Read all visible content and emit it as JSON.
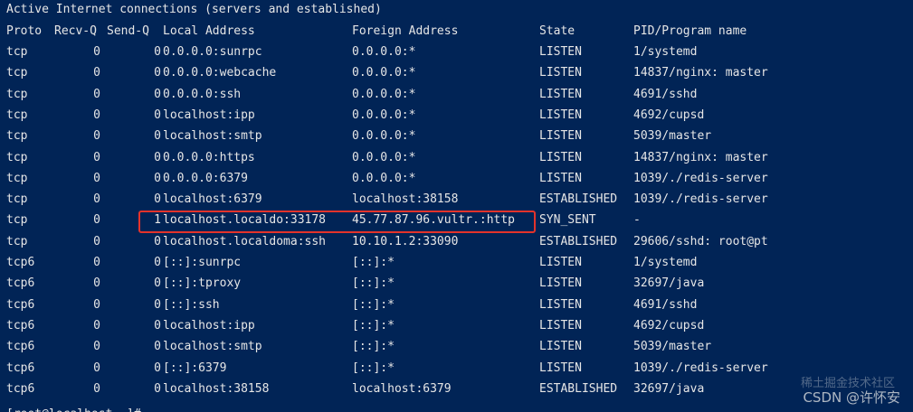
{
  "title_line": "Active Internet connections (servers and established)",
  "headers": {
    "proto": "Proto",
    "recv": "Recv-Q",
    "send": "Send-Q",
    "local": "Local Address",
    "foreign": "Foreign Address",
    "state": "State",
    "pid": "PID/Program name"
  },
  "rows": [
    {
      "proto": "tcp",
      "recv": "0",
      "send": "0",
      "local": "0.0.0.0:sunrpc",
      "foreign": "0.0.0.0:*",
      "state": "LISTEN",
      "pid": "1/systemd"
    },
    {
      "proto": "tcp",
      "recv": "0",
      "send": "0",
      "local": "0.0.0.0:webcache",
      "foreign": "0.0.0.0:*",
      "state": "LISTEN",
      "pid": "14837/nginx: master"
    },
    {
      "proto": "tcp",
      "recv": "0",
      "send": "0",
      "local": "0.0.0.0:ssh",
      "foreign": "0.0.0.0:*",
      "state": "LISTEN",
      "pid": "4691/sshd"
    },
    {
      "proto": "tcp",
      "recv": "0",
      "send": "0",
      "local": "localhost:ipp",
      "foreign": "0.0.0.0:*",
      "state": "LISTEN",
      "pid": "4692/cupsd"
    },
    {
      "proto": "tcp",
      "recv": "0",
      "send": "0",
      "local": "localhost:smtp",
      "foreign": "0.0.0.0:*",
      "state": "LISTEN",
      "pid": "5039/master"
    },
    {
      "proto": "tcp",
      "recv": "0",
      "send": "0",
      "local": "0.0.0.0:https",
      "foreign": "0.0.0.0:*",
      "state": "LISTEN",
      "pid": "14837/nginx: master"
    },
    {
      "proto": "tcp",
      "recv": "0",
      "send": "0",
      "local": "0.0.0.0:6379",
      "foreign": "0.0.0.0:*",
      "state": "LISTEN",
      "pid": "1039/./redis-server"
    },
    {
      "proto": "tcp",
      "recv": "0",
      "send": "0",
      "local": "localhost:6379",
      "foreign": "localhost:38158",
      "state": "ESTABLISHED",
      "pid": "1039/./redis-server"
    },
    {
      "proto": "tcp",
      "recv": "0",
      "send": "1",
      "local": "localhost.localdo:33178",
      "foreign": "45.77.87.96.vultr.:http",
      "state": "SYN_SENT",
      "pid": "-"
    },
    {
      "proto": "tcp",
      "recv": "0",
      "send": "0",
      "local": "localhost.localdoma:ssh",
      "foreign": "10.10.1.2:33090",
      "state": "ESTABLISHED",
      "pid": "29606/sshd: root@pt"
    },
    {
      "proto": "tcp6",
      "recv": "0",
      "send": "0",
      "local": "[::]:sunrpc",
      "foreign": "[::]:*",
      "state": "LISTEN",
      "pid": "1/systemd"
    },
    {
      "proto": "tcp6",
      "recv": "0",
      "send": "0",
      "local": "[::]:tproxy",
      "foreign": "[::]:*",
      "state": "LISTEN",
      "pid": "32697/java"
    },
    {
      "proto": "tcp6",
      "recv": "0",
      "send": "0",
      "local": "[::]:ssh",
      "foreign": "[::]:*",
      "state": "LISTEN",
      "pid": "4691/sshd"
    },
    {
      "proto": "tcp6",
      "recv": "0",
      "send": "0",
      "local": "localhost:ipp",
      "foreign": "[::]:*",
      "state": "LISTEN",
      "pid": "4692/cupsd"
    },
    {
      "proto": "tcp6",
      "recv": "0",
      "send": "0",
      "local": "localhost:smtp",
      "foreign": "[::]:*",
      "state": "LISTEN",
      "pid": "5039/master"
    },
    {
      "proto": "tcp6",
      "recv": "0",
      "send": "0",
      "local": "[::]:6379",
      "foreign": "[::]:*",
      "state": "LISTEN",
      "pid": "1039/./redis-server"
    },
    {
      "proto": "tcp6",
      "recv": "0",
      "send": "0",
      "local": "localhost:38158",
      "foreign": "localhost:6379",
      "state": "ESTABLISHED",
      "pid": "32697/java"
    }
  ],
  "prompt_partial": "[root@localhost ~]#",
  "watermark": "CSDN @许怀安",
  "watermark_ghost": "稀土掘金技术社区",
  "colors": {
    "background": "#012456",
    "text": "#e6e6e6",
    "highlight_border": "#e4332b"
  }
}
